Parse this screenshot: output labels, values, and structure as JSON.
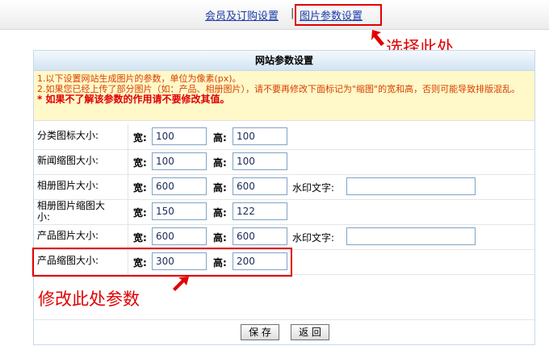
{
  "tabs": [
    {
      "label": "会员及订购设置"
    },
    {
      "label": "图片参数设置"
    }
  ],
  "annotations": {
    "select_here": "选择此处",
    "modify_here": "修改此处参数"
  },
  "panel": {
    "title": "网站参数设置",
    "notice": {
      "line1": "1.以下设置网站生成图片的参数，单位为像素(px)。",
      "line2": "2.如果您已经上传了部分图片（如：产品、相册图片），请不要再修改下面标记为\"缩图\"的宽和高，否则可能导致排版混乱。",
      "line3": "* 如果不了解该参数的作用请不要修改其值。"
    },
    "width_label": "宽:",
    "height_label": "高:",
    "watermark_label": "水印文字:",
    "rows": [
      {
        "label": "分类图标大小:",
        "width": "100",
        "height": "100",
        "watermark": null
      },
      {
        "label": "新闻缩图大小:",
        "width": "100",
        "height": "100",
        "watermark": null
      },
      {
        "label": "相册图片大小:",
        "width": "600",
        "height": "600",
        "watermark": ""
      },
      {
        "label": "相册图片缩图大小:",
        "width": "150",
        "height": "122",
        "watermark": null
      },
      {
        "label": "产品图片大小:",
        "width": "600",
        "height": "600",
        "watermark": ""
      },
      {
        "label": "产品缩图大小:",
        "width": "300",
        "height": "200",
        "watermark": null
      }
    ],
    "save_label": "保 存",
    "back_label": "返 回"
  },
  "colors": {
    "annotation_red": "#e00000",
    "tab_link": "#1a3aa8",
    "notice_bg": "#fff8c8",
    "notice_text": "#d84000"
  }
}
